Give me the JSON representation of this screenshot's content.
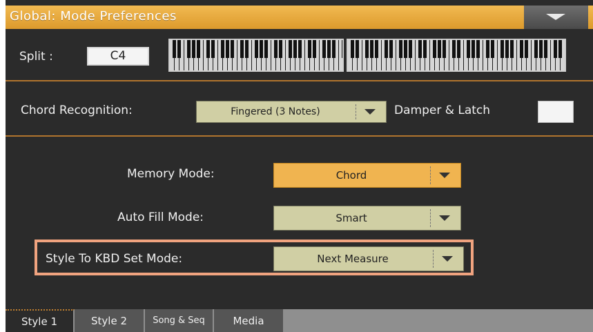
{
  "header": {
    "title": "Global: Mode Preferences",
    "menu_icon": "triangle-down-icon"
  },
  "split": {
    "label": "Split :",
    "value": "C4"
  },
  "chord": {
    "label": "Chord Recognition:",
    "value": "Fingered (3 Notes)",
    "damper_label": "Damper & Latch"
  },
  "memory_mode": {
    "label": "Memory Mode:",
    "value": "Chord"
  },
  "auto_fill": {
    "label": "Auto Fill Mode:",
    "value": "Smart"
  },
  "style_kbd": {
    "label": "Style To KBD Set Mode:",
    "value": "Next Measure"
  },
  "tabs": [
    {
      "label": "Style 1"
    },
    {
      "label": "Style 2"
    },
    {
      "label": "Song & Seq"
    },
    {
      "label": "Media"
    }
  ],
  "colors": {
    "title_bar": "#f0b450",
    "highlight": "#f0a37f",
    "active_combo": "#f0b450",
    "combo": "#d0cfa4"
  }
}
